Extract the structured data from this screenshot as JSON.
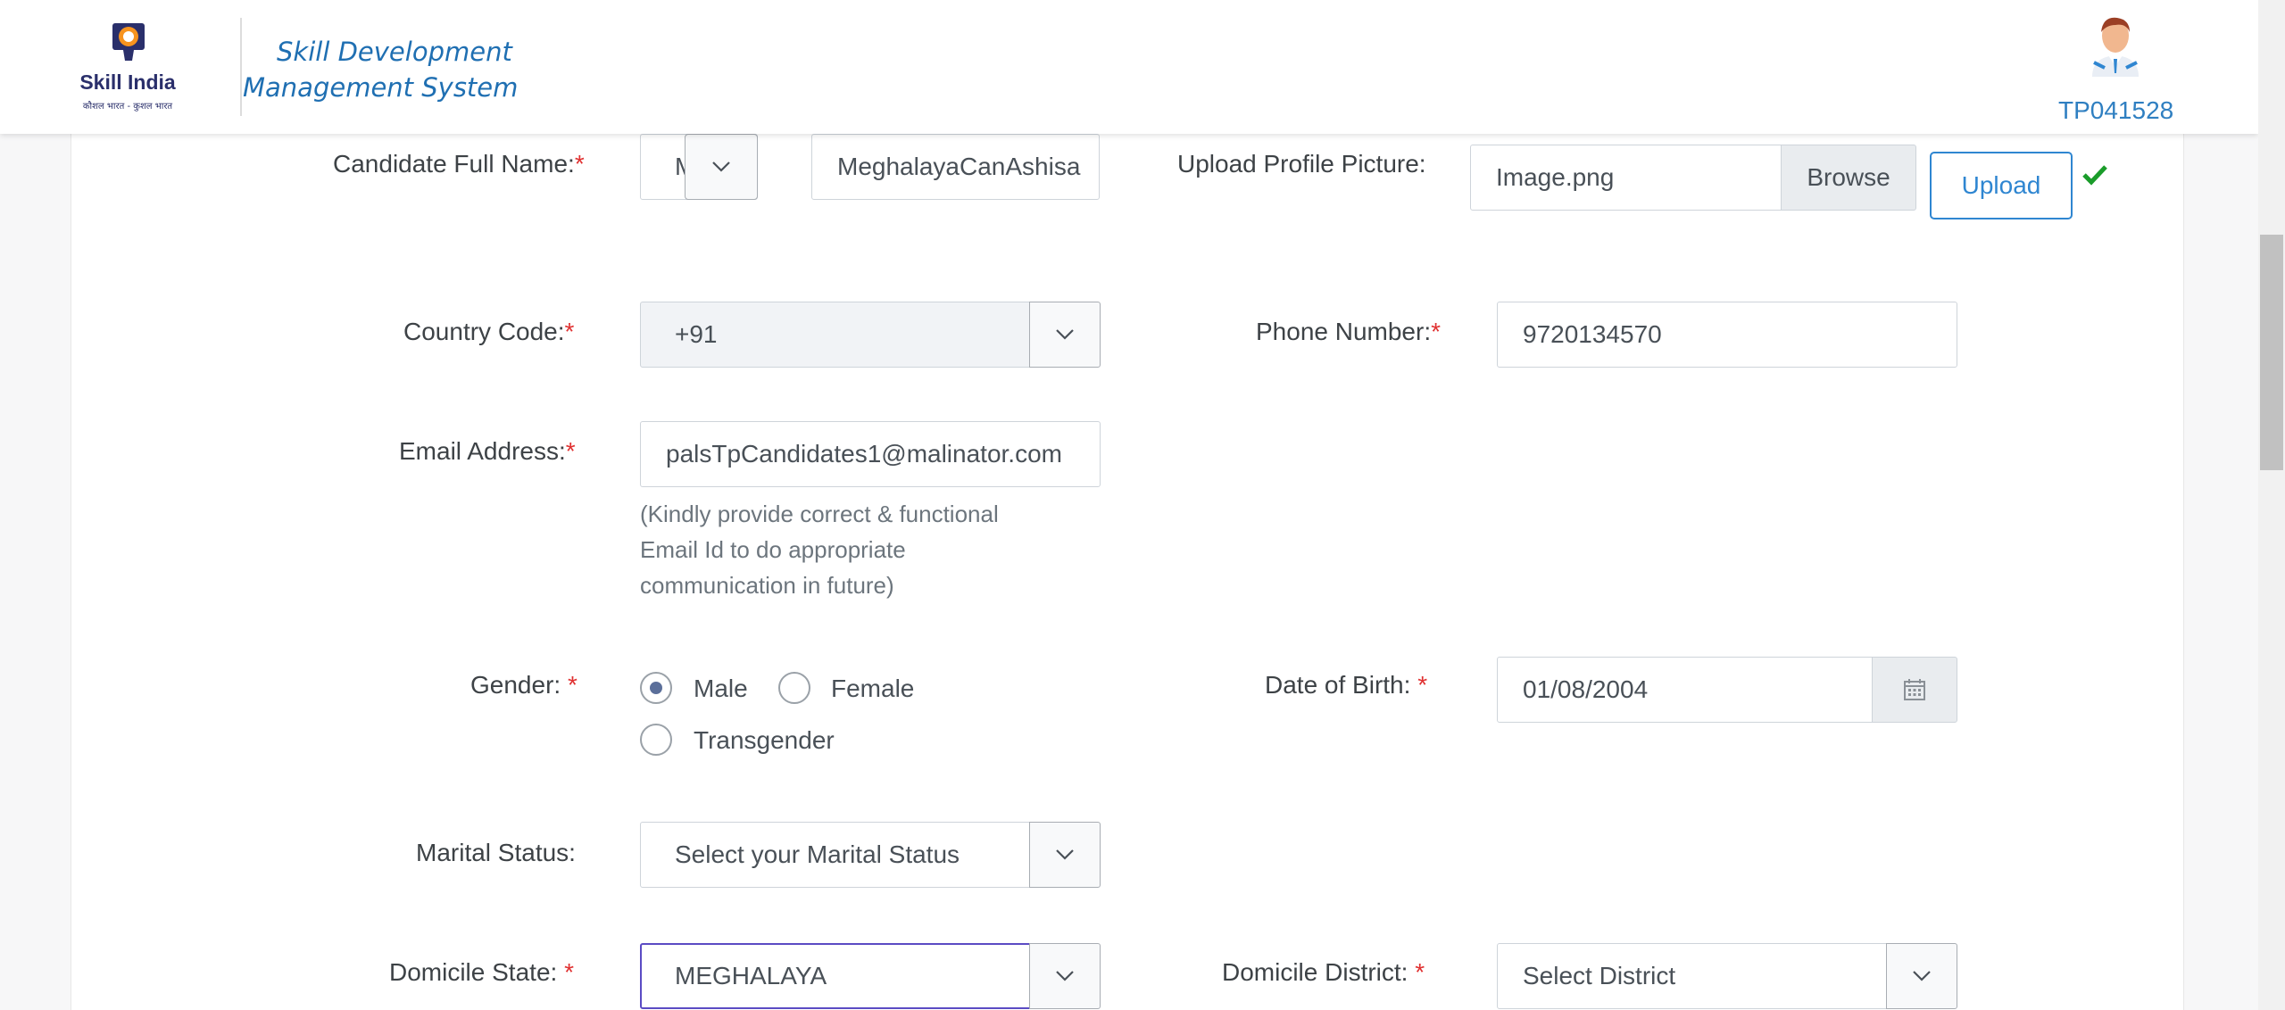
{
  "header": {
    "logo_text": "Skill India",
    "logo_tagline": "कौशल भारत - कुशल भारत",
    "title": "Skill Development Management System",
    "user_id": "TP041528"
  },
  "form": {
    "full_name": {
      "label": "Candidate Full Name:",
      "required": "*",
      "salutation_value": "M",
      "name_value": "MeghalayaCanAshisa"
    },
    "profile_picture": {
      "label": "Upload Profile Picture:",
      "file_value": "Image.png",
      "browse_label": "Browse",
      "upload_label": "Upload"
    },
    "country_code": {
      "label": "Country Code:",
      "required": "*",
      "value": "+91"
    },
    "phone": {
      "label": "Phone Number:",
      "required": "*",
      "value": "9720134570"
    },
    "email": {
      "label": "Email Address:",
      "required": "*",
      "value": "palsTpCandidates1@malinator.com",
      "hint_line1": "(Kindly provide correct & functional",
      "hint_line2": "Email Id to do appropriate",
      "hint_line3": "communication in future)"
    },
    "gender": {
      "label": "Gender: ",
      "required": "*",
      "options": [
        "Male",
        "Female",
        "Transgender"
      ],
      "selected": "Male"
    },
    "dob": {
      "label": "Date of Birth: ",
      "required": "*",
      "value": "01/08/2004"
    },
    "marital_status": {
      "label": "Marital Status:",
      "value": "Select your Marital Status"
    },
    "domicile_state": {
      "label": "Domicile State: ",
      "required": "*",
      "value": "MEGHALAYA"
    },
    "domicile_district": {
      "label": "Domicile District: ",
      "required": "*",
      "value": "Select District"
    }
  },
  "icons": {
    "caret": "chevron-down-icon",
    "calendar": "calendar-icon",
    "check": "check-icon",
    "avatar": "user-avatar"
  },
  "colors": {
    "brand_blue": "#1f6fb2",
    "required_red": "#e03131",
    "success_green": "#1a9c2a",
    "focus_border": "#5b4bc4"
  }
}
